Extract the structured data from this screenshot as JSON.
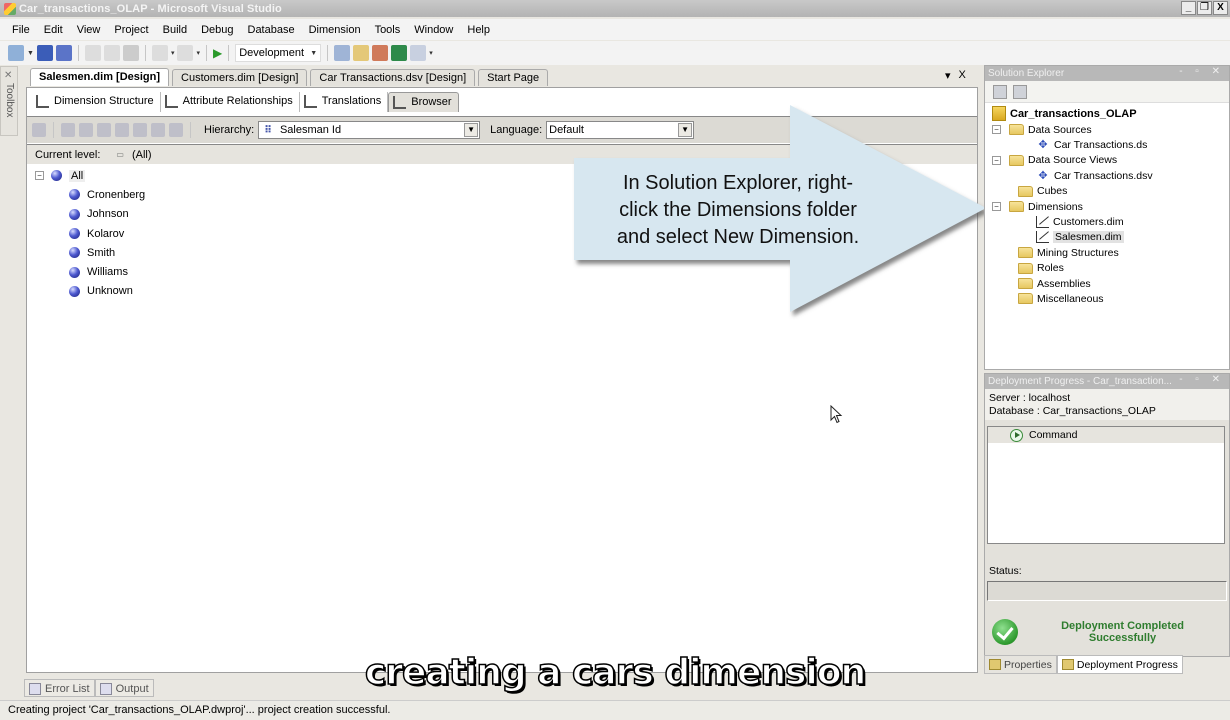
{
  "window": {
    "title": "Car_transactions_OLAP - Microsoft Visual Studio",
    "controls": [
      "minimize",
      "restore",
      "close"
    ]
  },
  "menu": [
    "File",
    "Edit",
    "View",
    "Project",
    "Build",
    "Debug",
    "Database",
    "Dimension",
    "Tools",
    "Window",
    "Help"
  ],
  "toolbar": {
    "configuration": "Development"
  },
  "toolbox": {
    "label": "Toolbox"
  },
  "doc_tabs": [
    {
      "label": "Salesmen.dim [Design]",
      "active": true
    },
    {
      "label": "Customers.dim [Design]",
      "active": false
    },
    {
      "label": "Car Transactions.dsv [Design]",
      "active": false
    },
    {
      "label": "Start Page",
      "active": false
    }
  ],
  "doc_tab_controls": {
    "dropdown": "▾",
    "close": "X"
  },
  "designer": {
    "subtabs": [
      {
        "label": "Dimension Structure",
        "active": false
      },
      {
        "label": "Attribute Relationships",
        "active": false
      },
      {
        "label": "Translations",
        "active": false
      },
      {
        "label": "Browser",
        "active": true
      }
    ],
    "hierarchy_label": "Hierarchy:",
    "hierarchy_value": "Salesman Id",
    "language_label": "Language:",
    "language_value": "Default",
    "current_level_label": "Current level:",
    "current_level_value": "(All)",
    "tree": {
      "root": "All",
      "members": [
        "Cronenberg",
        "Johnson",
        "Kolarov",
        "Smith",
        "Williams",
        "Unknown"
      ]
    }
  },
  "callout": {
    "text_lines": [
      "In Solution Explorer, right-",
      "click the Dimensions folder",
      "and select New Dimension."
    ],
    "fill": "#d7e7f0"
  },
  "solution_explorer": {
    "title": "Solution Explorer",
    "header_controls": "- ▫ X",
    "project": "Car_transactions_OLAP",
    "nodes": [
      {
        "label": "Data Sources",
        "type": "folder",
        "expanded": true,
        "children": [
          {
            "label": "Car Transactions.ds",
            "type": "datasource"
          }
        ]
      },
      {
        "label": "Data Source Views",
        "type": "folder",
        "expanded": true,
        "children": [
          {
            "label": "Car Transactions.dsv",
            "type": "dsv"
          }
        ]
      },
      {
        "label": "Cubes",
        "type": "folder"
      },
      {
        "label": "Dimensions",
        "type": "folder",
        "expanded": true,
        "children": [
          {
            "label": "Customers.dim",
            "type": "dimension"
          },
          {
            "label": "Salesmen.dim",
            "type": "dimension",
            "selected": true
          }
        ]
      },
      {
        "label": "Mining Structures",
        "type": "folder"
      },
      {
        "label": "Roles",
        "type": "folder"
      },
      {
        "label": "Assemblies",
        "type": "folder"
      },
      {
        "label": "Miscellaneous",
        "type": "folder"
      }
    ]
  },
  "deployment_progress": {
    "title": "Deployment Progress - Car_transaction...",
    "server_line": "Server :  localhost",
    "database_line": "Database : Car_transactions_OLAP",
    "command": "Command",
    "status_label": "Status:",
    "status_value": "",
    "result_line1": "Deployment Completed",
    "result_line2": "Successfully",
    "result_color": "#2f7d2f"
  },
  "right_tabs": [
    {
      "label": "Properties",
      "active": false
    },
    {
      "label": "Deployment Progress",
      "active": true
    }
  ],
  "bottom_tabs": [
    "Error List",
    "Output"
  ],
  "status_bar": "Creating project 'Car_transactions_OLAP.dwproj'... project creation successful.",
  "subtitle": "creating a cars dimension"
}
